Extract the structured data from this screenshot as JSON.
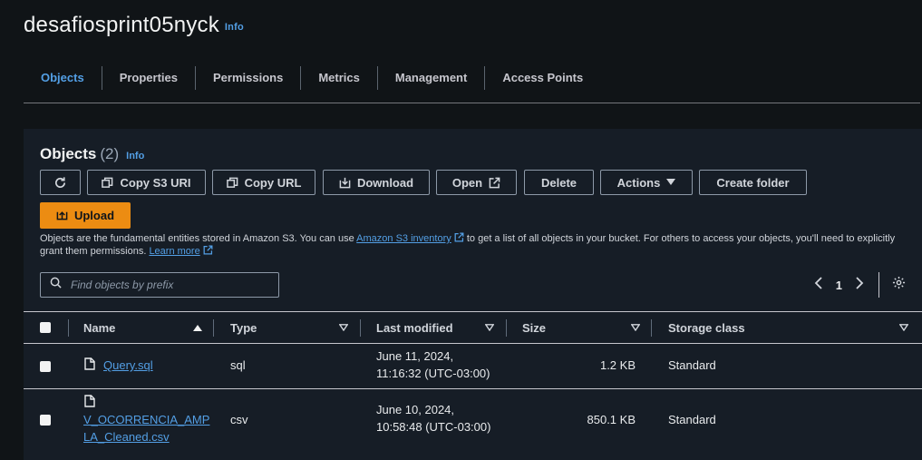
{
  "bucket": {
    "name": "desafiosprint05nyck",
    "info": "Info"
  },
  "tabs": [
    {
      "label": "Objects",
      "active": true
    },
    {
      "label": "Properties"
    },
    {
      "label": "Permissions"
    },
    {
      "label": "Metrics"
    },
    {
      "label": "Management"
    },
    {
      "label": "Access Points"
    }
  ],
  "objects": {
    "title": "Objects",
    "count": "(2)",
    "info": "Info",
    "toolbar": {
      "refresh_icon": "refresh-icon",
      "copy_s3_uri": "Copy S3 URI",
      "copy_url": "Copy URL",
      "download": "Download",
      "open": "Open",
      "delete": "Delete",
      "actions": "Actions",
      "create_folder": "Create folder",
      "upload": "Upload"
    },
    "description": {
      "part1": "Objects are the fundamental entities stored in Amazon S3. You can use ",
      "inventory_link": "Amazon S3 inventory",
      "part2": " to get a list of all objects in your bucket. For others to access your objects, you'll need to explicitly grant them permissions. ",
      "learn_more": "Learn more"
    },
    "search": {
      "placeholder": "Find objects by prefix"
    },
    "pagination": {
      "page": "1"
    },
    "table": {
      "columns": [
        "Name",
        "Type",
        "Last modified",
        "Size",
        "Storage class"
      ],
      "rows": [
        {
          "name": "Query.sql",
          "type": "sql",
          "modified_line1": "June 11, 2024,",
          "modified_line2": "11:16:32 (UTC-03:00)",
          "size": "1.2 KB",
          "storage_class": "Standard"
        },
        {
          "name_line1": "V_OCORRENCIA_AMP",
          "name_line2": "LA_Cleaned.csv",
          "type": "csv",
          "modified_line1": "June 10, 2024,",
          "modified_line2": "10:58:48 (UTC-03:00)",
          "size": "850.1 KB",
          "storage_class": "Standard"
        }
      ]
    }
  },
  "colors": {
    "accent": "#539fe5",
    "upload": "#ec8c12",
    "background": "#101417",
    "panel": "#161d26"
  }
}
